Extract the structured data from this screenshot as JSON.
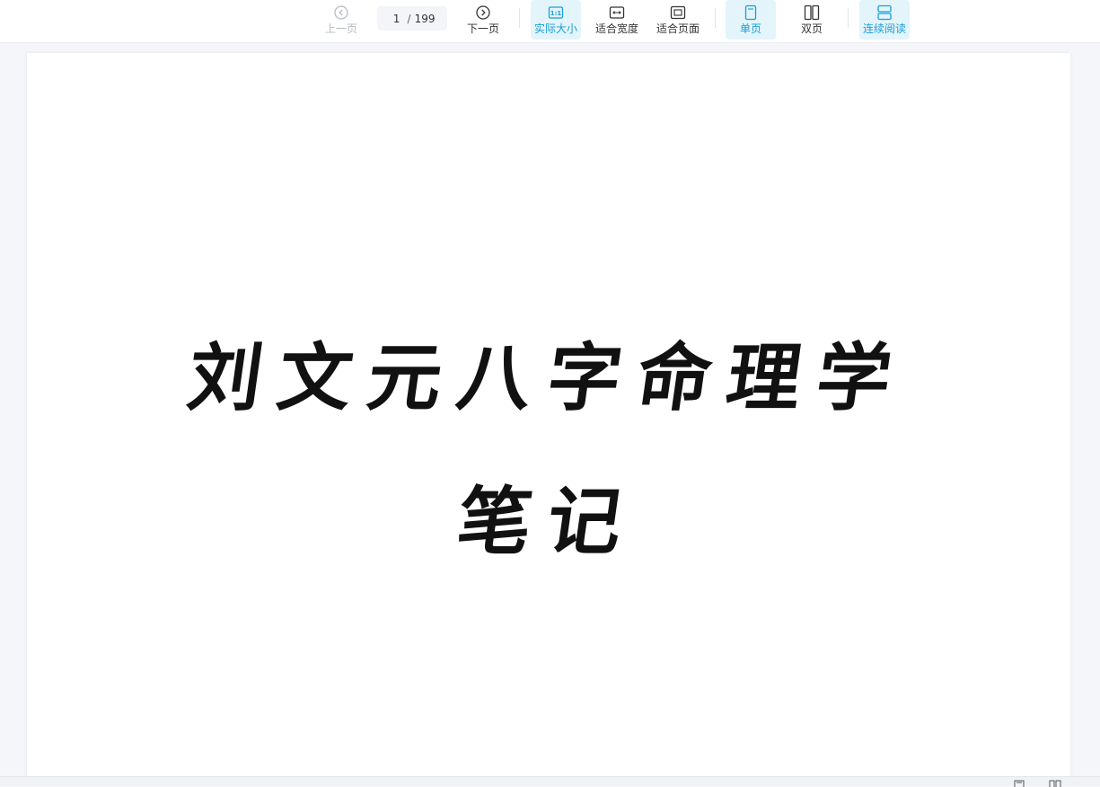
{
  "toolbar": {
    "prev_page": "上一页",
    "current_page": "1",
    "page_separator": "/",
    "total_pages": "199",
    "next_page": "下一页",
    "actual_size": "实际大小",
    "actual_size_icon_text": "1:1",
    "fit_width": "适合宽度",
    "fit_page": "适合页面",
    "single_page": "单页",
    "double_page": "双页",
    "continuous_read": "连续阅读"
  },
  "document": {
    "title_line1": "刘文元八字命理学",
    "title_line2": "笔记"
  },
  "colors": {
    "accent": "#1a9fd6",
    "active_bg": "#e3f4fb",
    "disabled": "#b8bcc4"
  }
}
